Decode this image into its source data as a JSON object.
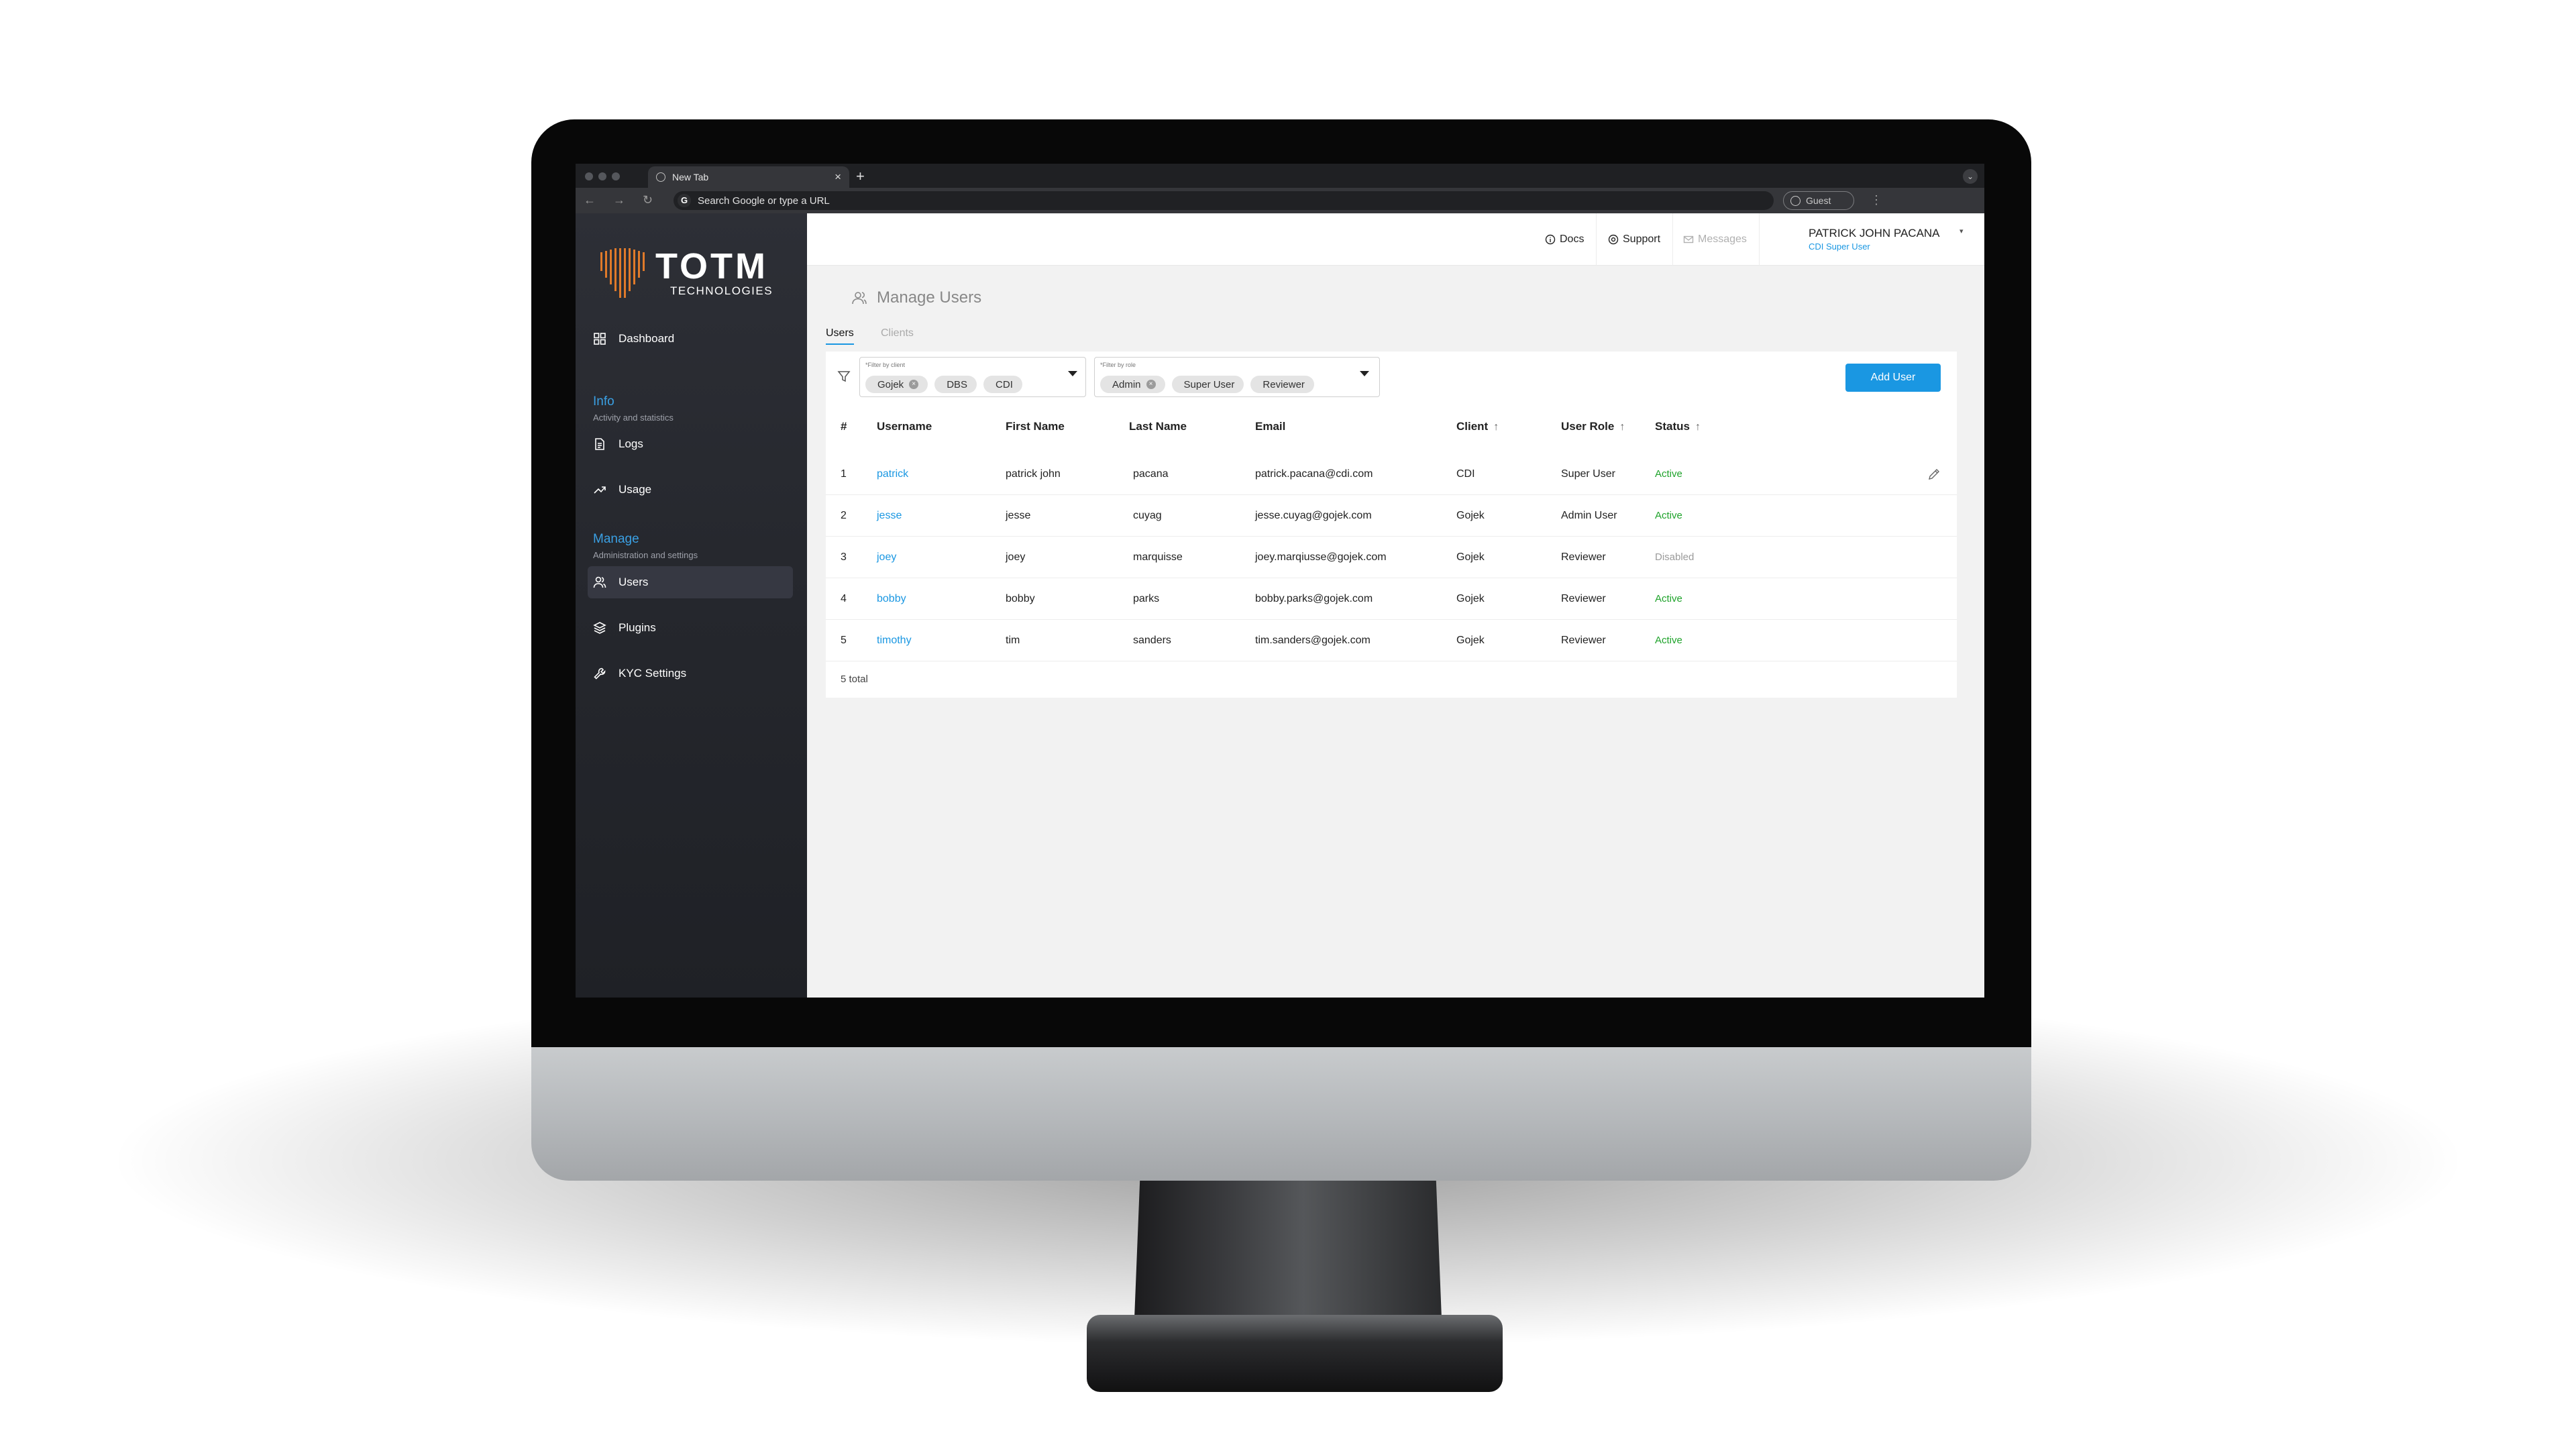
{
  "browser": {
    "tab_title": "New Tab",
    "tab_close": "×",
    "new_tab": "+",
    "omnibox_placeholder": "Search Google or type a URL",
    "omnibox_icon": "G",
    "guest_label": "Guest",
    "menu": "⋮",
    "caret": "⌄"
  },
  "sidebar": {
    "logo_name": "TOTM",
    "logo_sub": "TECHNOLOGIES",
    "dashboard": "Dashboard",
    "info_title": "Info",
    "info_sub": "Activity and statistics",
    "logs": "Logs",
    "usage": "Usage",
    "manage_title": "Manage",
    "manage_sub": "Administration and settings",
    "users": "Users",
    "plugins": "Plugins",
    "kyc_settings": "KYC Settings"
  },
  "topbar": {
    "docs": "Docs",
    "support": "Support",
    "messages": "Messages",
    "user_name": "PATRICK JOHN PACANA",
    "user_role": "CDI Super User"
  },
  "page": {
    "title": "Manage Users",
    "tabs": [
      "Users",
      "Clients"
    ]
  },
  "filters": {
    "client_label": "*Filter by client",
    "client_chips": [
      "Gojek",
      "DBS",
      "CDI"
    ],
    "role_label": "*Filter by role",
    "role_chips": [
      "Admin",
      "Super User",
      "Reviewer"
    ],
    "add_user": "Add User"
  },
  "table": {
    "headers": [
      "#",
      "Username",
      "First Name",
      "Last Name",
      "Email",
      "Client",
      "User Role",
      "Status"
    ],
    "rows": [
      {
        "n": "1",
        "username": "patrick",
        "first": "patrick john",
        "last": "pacana",
        "email": "patrick.pacana@cdi.com",
        "client": "CDI",
        "role": "Super User",
        "status": "Active"
      },
      {
        "n": "2",
        "username": "jesse",
        "first": "jesse",
        "last": "cuyag",
        "email": "jesse.cuyag@gojek.com",
        "client": "Gojek",
        "role": "Admin User",
        "status": "Active"
      },
      {
        "n": "3",
        "username": "joey",
        "first": "joey",
        "last": "marquisse",
        "email": "joey.marqiusse@gojek.com",
        "client": "Gojek",
        "role": "Reviewer",
        "status": "Disabled"
      },
      {
        "n": "4",
        "username": "bobby",
        "first": "bobby",
        "last": "parks",
        "email": "bobby.parks@gojek.com",
        "client": "Gojek",
        "role": "Reviewer",
        "status": "Active"
      },
      {
        "n": "5",
        "username": "timothy",
        "first": "tim",
        "last": "sanders",
        "email": "tim.sanders@gojek.com",
        "client": "Gojek",
        "role": "Reviewer",
        "status": "Active"
      }
    ],
    "total": "5 total"
  },
  "colors": {
    "accent": "#1a97e2",
    "active": "#1fa32b",
    "logo_orange": "#e07a2a"
  }
}
